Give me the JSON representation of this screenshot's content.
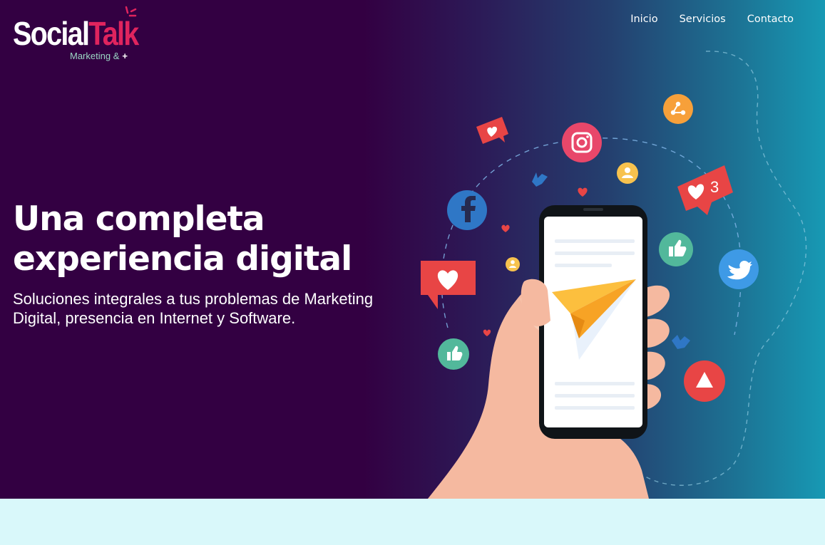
{
  "brand": {
    "name_part1": "Social",
    "name_part2": "Talk",
    "tagline": "Marketing &",
    "tagline_plus": "+",
    "colors": {
      "talk": "#e0245e",
      "tagline": "#9bd7c4"
    }
  },
  "nav": {
    "items": [
      {
        "label": "Inicio"
      },
      {
        "label": "Servicios"
      },
      {
        "label": "Contacto"
      }
    ]
  },
  "hero": {
    "title_line1": "Una completa",
    "title_line2": "experiencia digital",
    "subtitle_line1": "Soluciones integrales a tus problemas de Marketing",
    "subtitle_line2": "Digital, presencia en Internet y Software.",
    "background_colors": [
      "#330042",
      "#1799b4"
    ]
  },
  "illustration": {
    "icons": [
      "instagram-icon",
      "facebook-icon",
      "twitter-icon",
      "share-icon",
      "like-icon",
      "heart-icon",
      "notification-heart-3-icon",
      "user-icon",
      "youtube-play-icon",
      "paper-plane-icon",
      "smartphone-icon",
      "hand-icon"
    ],
    "notification_count": "3"
  },
  "page": {
    "below_fold_color": "#d9f8fa"
  }
}
